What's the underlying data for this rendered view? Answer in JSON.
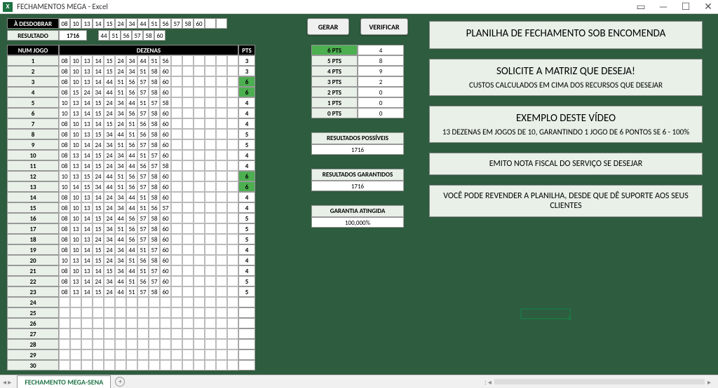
{
  "titlebar": {
    "title": "FECHAMENTOS MEGA - Excel",
    "excel_icon": "X"
  },
  "labels": {
    "desdobrar": "À DESDOBRAR",
    "resultado": "RESULTADO",
    "num_jogo": "NUM JOGO",
    "dezenas": "DEZENAS",
    "pts": "PTS"
  },
  "desdobrar_nums": [
    "08",
    "10",
    "13",
    "14",
    "15",
    "24",
    "34",
    "44",
    "51",
    "56",
    "57",
    "58",
    "60"
  ],
  "resultado_nums": [
    "1716",
    "",
    "44",
    "51",
    "56",
    "57",
    "58",
    "60"
  ],
  "buttons": {
    "gerar": "GERAR",
    "verificar": "VERIFICAR"
  },
  "rows": [
    {
      "idx": "1",
      "nums": [
        "08",
        "10",
        "13",
        "14",
        "15",
        "24",
        "34",
        "44",
        "51",
        "56",
        "",
        "",
        "",
        "",
        "",
        ""
      ],
      "pts": "3",
      "hit": false
    },
    {
      "idx": "2",
      "nums": [
        "08",
        "10",
        "13",
        "14",
        "15",
        "24",
        "34",
        "51",
        "58",
        "60",
        "",
        "",
        "",
        "",
        "",
        ""
      ],
      "pts": "3",
      "hit": false
    },
    {
      "idx": "3",
      "nums": [
        "08",
        "10",
        "13",
        "14",
        "44",
        "51",
        "56",
        "57",
        "58",
        "60",
        "",
        "",
        "",
        "",
        "",
        ""
      ],
      "pts": "6",
      "hit": true
    },
    {
      "idx": "4",
      "nums": [
        "08",
        "15",
        "24",
        "34",
        "44",
        "51",
        "56",
        "57",
        "58",
        "60",
        "",
        "",
        "",
        "",
        "",
        ""
      ],
      "pts": "6",
      "hit": true
    },
    {
      "idx": "5",
      "nums": [
        "10",
        "13",
        "14",
        "15",
        "24",
        "34",
        "44",
        "51",
        "57",
        "58",
        "",
        "",
        "",
        "",
        "",
        ""
      ],
      "pts": "4",
      "hit": false
    },
    {
      "idx": "6",
      "nums": [
        "10",
        "13",
        "14",
        "15",
        "24",
        "34",
        "56",
        "57",
        "58",
        "60",
        "",
        "",
        "",
        "",
        "",
        ""
      ],
      "pts": "4",
      "hit": false
    },
    {
      "idx": "7",
      "nums": [
        "08",
        "10",
        "13",
        "14",
        "15",
        "24",
        "51",
        "56",
        "58",
        "60",
        "",
        "",
        "",
        "",
        "",
        ""
      ],
      "pts": "4",
      "hit": false
    },
    {
      "idx": "8",
      "nums": [
        "08",
        "10",
        "13",
        "15",
        "34",
        "44",
        "51",
        "56",
        "58",
        "60",
        "",
        "",
        "",
        "",
        "",
        ""
      ],
      "pts": "5",
      "hit": false
    },
    {
      "idx": "9",
      "nums": [
        "08",
        "10",
        "14",
        "24",
        "34",
        "51",
        "56",
        "57",
        "58",
        "60",
        "",
        "",
        "",
        "",
        "",
        ""
      ],
      "pts": "5",
      "hit": false
    },
    {
      "idx": "10",
      "nums": [
        "08",
        "13",
        "14",
        "15",
        "24",
        "34",
        "44",
        "51",
        "57",
        "60",
        "",
        "",
        "",
        "",
        "",
        ""
      ],
      "pts": "4",
      "hit": false
    },
    {
      "idx": "11",
      "nums": [
        "08",
        "13",
        "14",
        "15",
        "24",
        "34",
        "44",
        "56",
        "57",
        "58",
        "",
        "",
        "",
        "",
        "",
        ""
      ],
      "pts": "4",
      "hit": false
    },
    {
      "idx": "12",
      "nums": [
        "10",
        "13",
        "15",
        "24",
        "44",
        "51",
        "56",
        "57",
        "58",
        "60",
        "",
        "",
        "",
        "",
        "",
        ""
      ],
      "pts": "6",
      "hit": true
    },
    {
      "idx": "13",
      "nums": [
        "10",
        "14",
        "15",
        "34",
        "44",
        "51",
        "56",
        "57",
        "58",
        "60",
        "",
        "",
        "",
        "",
        "",
        ""
      ],
      "pts": "6",
      "hit": true
    },
    {
      "idx": "14",
      "nums": [
        "08",
        "10",
        "13",
        "14",
        "24",
        "34",
        "44",
        "51",
        "58",
        "60",
        "",
        "",
        "",
        "",
        "",
        ""
      ],
      "pts": "4",
      "hit": false
    },
    {
      "idx": "15",
      "nums": [
        "08",
        "10",
        "13",
        "15",
        "24",
        "34",
        "44",
        "51",
        "56",
        "57",
        "",
        "",
        "",
        "",
        "",
        ""
      ],
      "pts": "4",
      "hit": false
    },
    {
      "idx": "16",
      "nums": [
        "08",
        "10",
        "14",
        "15",
        "24",
        "44",
        "56",
        "57",
        "58",
        "60",
        "",
        "",
        "",
        "",
        "",
        ""
      ],
      "pts": "5",
      "hit": false
    },
    {
      "idx": "17",
      "nums": [
        "08",
        "13",
        "14",
        "15",
        "34",
        "51",
        "56",
        "57",
        "58",
        "60",
        "",
        "",
        "",
        "",
        "",
        ""
      ],
      "pts": "5",
      "hit": false
    },
    {
      "idx": "18",
      "nums": [
        "08",
        "10",
        "13",
        "24",
        "34",
        "44",
        "56",
        "57",
        "58",
        "60",
        "",
        "",
        "",
        "",
        "",
        ""
      ],
      "pts": "5",
      "hit": false
    },
    {
      "idx": "19",
      "nums": [
        "08",
        "10",
        "14",
        "15",
        "24",
        "34",
        "44",
        "51",
        "57",
        "60",
        "",
        "",
        "",
        "",
        "",
        ""
      ],
      "pts": "4",
      "hit": false
    },
    {
      "idx": "20",
      "nums": [
        "10",
        "13",
        "14",
        "15",
        "24",
        "34",
        "51",
        "56",
        "58",
        "60",
        "",
        "",
        "",
        "",
        "",
        ""
      ],
      "pts": "4",
      "hit": false
    },
    {
      "idx": "21",
      "nums": [
        "08",
        "10",
        "13",
        "14",
        "15",
        "34",
        "44",
        "51",
        "57",
        "60",
        "",
        "",
        "",
        "",
        "",
        ""
      ],
      "pts": "4",
      "hit": false
    },
    {
      "idx": "22",
      "nums": [
        "08",
        "13",
        "14",
        "24",
        "34",
        "44",
        "51",
        "56",
        "57",
        "60",
        "",
        "",
        "",
        "",
        "",
        ""
      ],
      "pts": "5",
      "hit": false
    },
    {
      "idx": "23",
      "nums": [
        "08",
        "13",
        "14",
        "15",
        "24",
        "44",
        "51",
        "57",
        "58",
        "60",
        "",
        "",
        "",
        "",
        "",
        ""
      ],
      "pts": "5",
      "hit": false
    },
    {
      "idx": "24",
      "nums": [
        "",
        "",
        "",
        "",
        "",
        "",
        "",
        "",
        "",
        "",
        "",
        "",
        "",
        "",
        "",
        ""
      ],
      "pts": "",
      "hit": false
    },
    {
      "idx": "25",
      "nums": [
        "",
        "",
        "",
        "",
        "",
        "",
        "",
        "",
        "",
        "",
        "",
        "",
        "",
        "",
        "",
        ""
      ],
      "pts": "",
      "hit": false
    },
    {
      "idx": "26",
      "nums": [
        "",
        "",
        "",
        "",
        "",
        "",
        "",
        "",
        "",
        "",
        "",
        "",
        "",
        "",
        "",
        ""
      ],
      "pts": "",
      "hit": false
    },
    {
      "idx": "27",
      "nums": [
        "",
        "",
        "",
        "",
        "",
        "",
        "",
        "",
        "",
        "",
        "",
        "",
        "",
        "",
        "",
        ""
      ],
      "pts": "",
      "hit": false
    },
    {
      "idx": "28",
      "nums": [
        "",
        "",
        "",
        "",
        "",
        "",
        "",
        "",
        "",
        "",
        "",
        "",
        "",
        "",
        "",
        ""
      ],
      "pts": "",
      "hit": false
    },
    {
      "idx": "29",
      "nums": [
        "",
        "",
        "",
        "",
        "",
        "",
        "",
        "",
        "",
        "",
        "",
        "",
        "",
        "",
        "",
        ""
      ],
      "pts": "",
      "hit": false
    },
    {
      "idx": "30",
      "nums": [
        "",
        "",
        "",
        "",
        "",
        "",
        "",
        "",
        "",
        "",
        "",
        "",
        "",
        "",
        "",
        ""
      ],
      "pts": "",
      "hit": false
    }
  ],
  "stats": [
    {
      "label": "6 PTS",
      "val": "4",
      "hit": true
    },
    {
      "label": "5 PTS",
      "val": "8",
      "hit": false
    },
    {
      "label": "4 PTS",
      "val": "9",
      "hit": false
    },
    {
      "label": "3 PTS",
      "val": "2",
      "hit": false
    },
    {
      "label": "2 PTS",
      "val": "0",
      "hit": false
    },
    {
      "label": "1 PTS",
      "val": "0",
      "hit": false
    },
    {
      "label": "0 PTS",
      "val": "0",
      "hit": false
    }
  ],
  "boxes": {
    "res_poss_label": "RESULTADOS POSSÍVEIS",
    "res_poss_val": "1716",
    "res_gar_label": "RESULTADOS GARANTIDOS",
    "res_gar_val": "1716",
    "gar_at_label": "GARANTIA ATINGIDA",
    "gar_at_val": "100,000%"
  },
  "info": {
    "b1_big": "PLANILHA DE FECHAMENTO SOB ENCOMENDA",
    "b2_big": "SOLICITE A MATRIZ QUE DESEJA!",
    "b2_small": "CUSTOS CALCULADOS EM CIMA DOS RECURSOS QUE DESEJAR",
    "b3_big": "EXEMPLO DESTE VÍDEO",
    "b3_small": "13 DEZENAS EM JOGOS DE 10, GARANTINDO 1 JOGO DE 6 PONTOS SE 6 - 100%",
    "b4": "EMITO NOTA FISCAL DO SERVIÇO SE DESEJAR",
    "b5": "VOCÊ PODE REVENDER A PLANILHA, DESDE QUE DÊ SUPORTE AOS SEUS CLIENTES"
  },
  "tab": {
    "name": "FECHAMENTO MEGA-SENA"
  }
}
